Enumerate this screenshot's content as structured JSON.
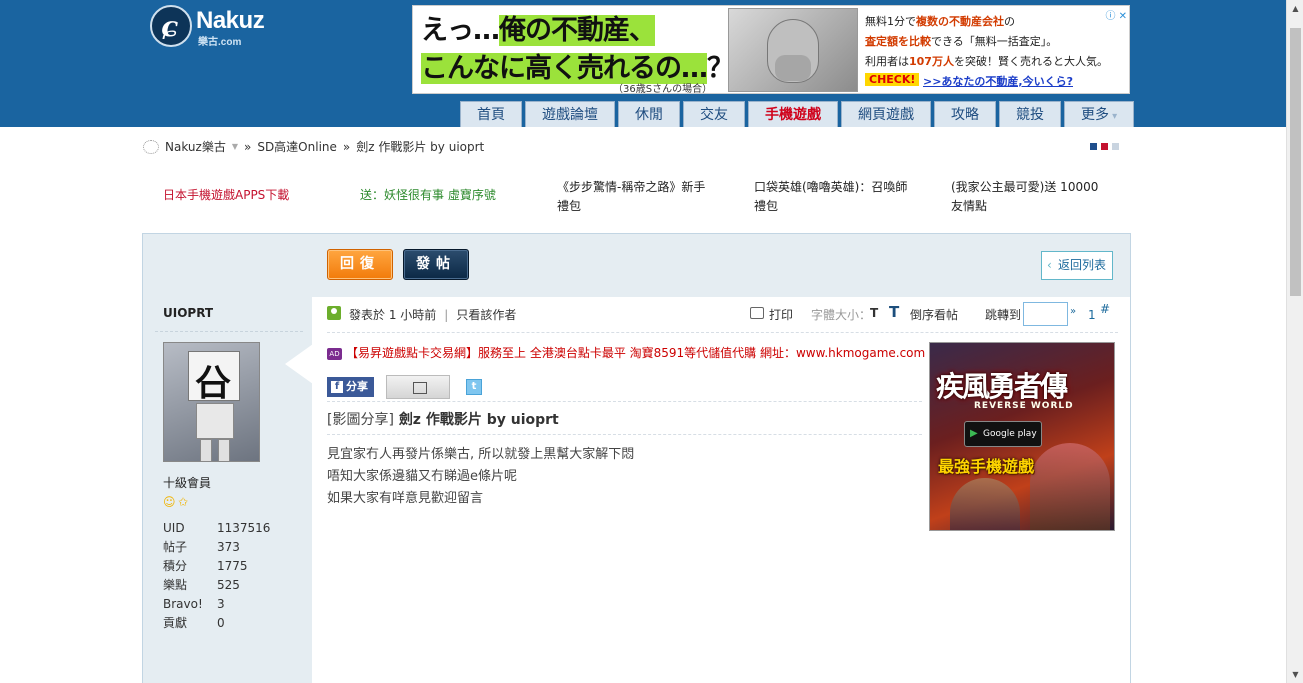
{
  "header": {
    "logo": {
      "name": "Nakuz",
      "sub": "樂古.com"
    }
  },
  "top_ad": {
    "line1_pre": "えっ…",
    "line1_hl": "俺の不動産、",
    "line2_hl": "こんなに高く売れるの…",
    "line2_post": "？",
    "note": "（36歳Sさんの場合）",
    "text1_pre": "無料1分で",
    "text1_r": "複数の不動産会社",
    "text1_post": "の",
    "text2_r": "査定額を比較",
    "text2_post": "できる「無料一括査定」。",
    "text3_pre": "利用者は",
    "text3_r": "107万人",
    "text3_post": "を突破！賢く売れると大人気。",
    "check": "CHECK!",
    "link": ">>あなたの不動産,今いくら?",
    "adx": "ⓘ ✕"
  },
  "nav": {
    "items": [
      {
        "label": "首頁"
      },
      {
        "label": "遊戲論壇"
      },
      {
        "label": "休閒"
      },
      {
        "label": "交友"
      },
      {
        "label": "手機遊戲",
        "hot": true
      },
      {
        "label": "網頁遊戲"
      },
      {
        "label": "攻略"
      },
      {
        "label": "競投"
      },
      {
        "label": "更多",
        "more": true
      }
    ]
  },
  "breadcrumb": {
    "site": "Nakuz樂古",
    "sep1": "»",
    "forum": "SD高達Online",
    "sep2": "»",
    "thread": "劍z 作戰影片 by uioprt"
  },
  "style_colors": [
    "#1f4e8c",
    "#c4122f",
    "#c9d4e0"
  ],
  "links_row": [
    {
      "text": "日本手機遊戲APPS下載",
      "color": "#c4122f"
    },
    {
      "text": "送：妖怪很有事 虛寶序號",
      "color": "#2d8a2d"
    },
    {
      "text": "《步步驚情-稱帝之路》新手禮包",
      "color": "#222222"
    },
    {
      "text": "口袋英雄(嚕嚕英雄)：召喚師禮包",
      "color": "#222222"
    },
    {
      "text": "(我家公主最可愛)送 10000 友情點",
      "color": "#222222"
    }
  ],
  "actions": {
    "reply": "回復",
    "post": "發帖",
    "back": "返回列表"
  },
  "author": {
    "name": "UIOPRT",
    "avatar_glyph": "㕣",
    "rank": "十級會員",
    "stats": [
      {
        "k": "UID",
        "v": "1137516"
      },
      {
        "k": "帖子",
        "v": "373"
      },
      {
        "k": "積分",
        "v": "1775"
      },
      {
        "k": "樂點",
        "v": "525"
      },
      {
        "k": "Bravo!",
        "v": "3"
      },
      {
        "k": "貢獻",
        "v": "0"
      }
    ]
  },
  "post": {
    "posted": "發表於 1 小時前",
    "sep": "|",
    "only_author": "只看該作者",
    "print": "打印",
    "font_size": "字體大小：",
    "font_t": "T",
    "reverse_glyph": "T",
    "reverse": "倒序看帖",
    "jump": "跳轉到",
    "jump_go": "»",
    "page": "1",
    "floor": "#",
    "ad_badge": "AD",
    "ad_text": "【易昇遊戲點卡交易網】服務至上 全港澳台點卡最平 淘寶8591等代儲值代購 網址：www.hkmogame.com",
    "share_fb": "分享",
    "share_fb_glyph": "f",
    "share_tw_glyph": "t",
    "title_tag": "[影圖分享]",
    "title": "劍z 作戰影片 by uioprt",
    "content": [
      "見宜家冇人再發片係樂古, 所以就發上黒幫大家解下悶",
      "唔知大家係邊貓又冇睇過e條片呢",
      "如果大家有咩意見歡迎留言"
    ]
  },
  "side_ad": {
    "title": "疾風勇者傳",
    "sub": "REVERSE WORLD",
    "gp": "Google play",
    "slogan": "最強手機遊戲"
  }
}
